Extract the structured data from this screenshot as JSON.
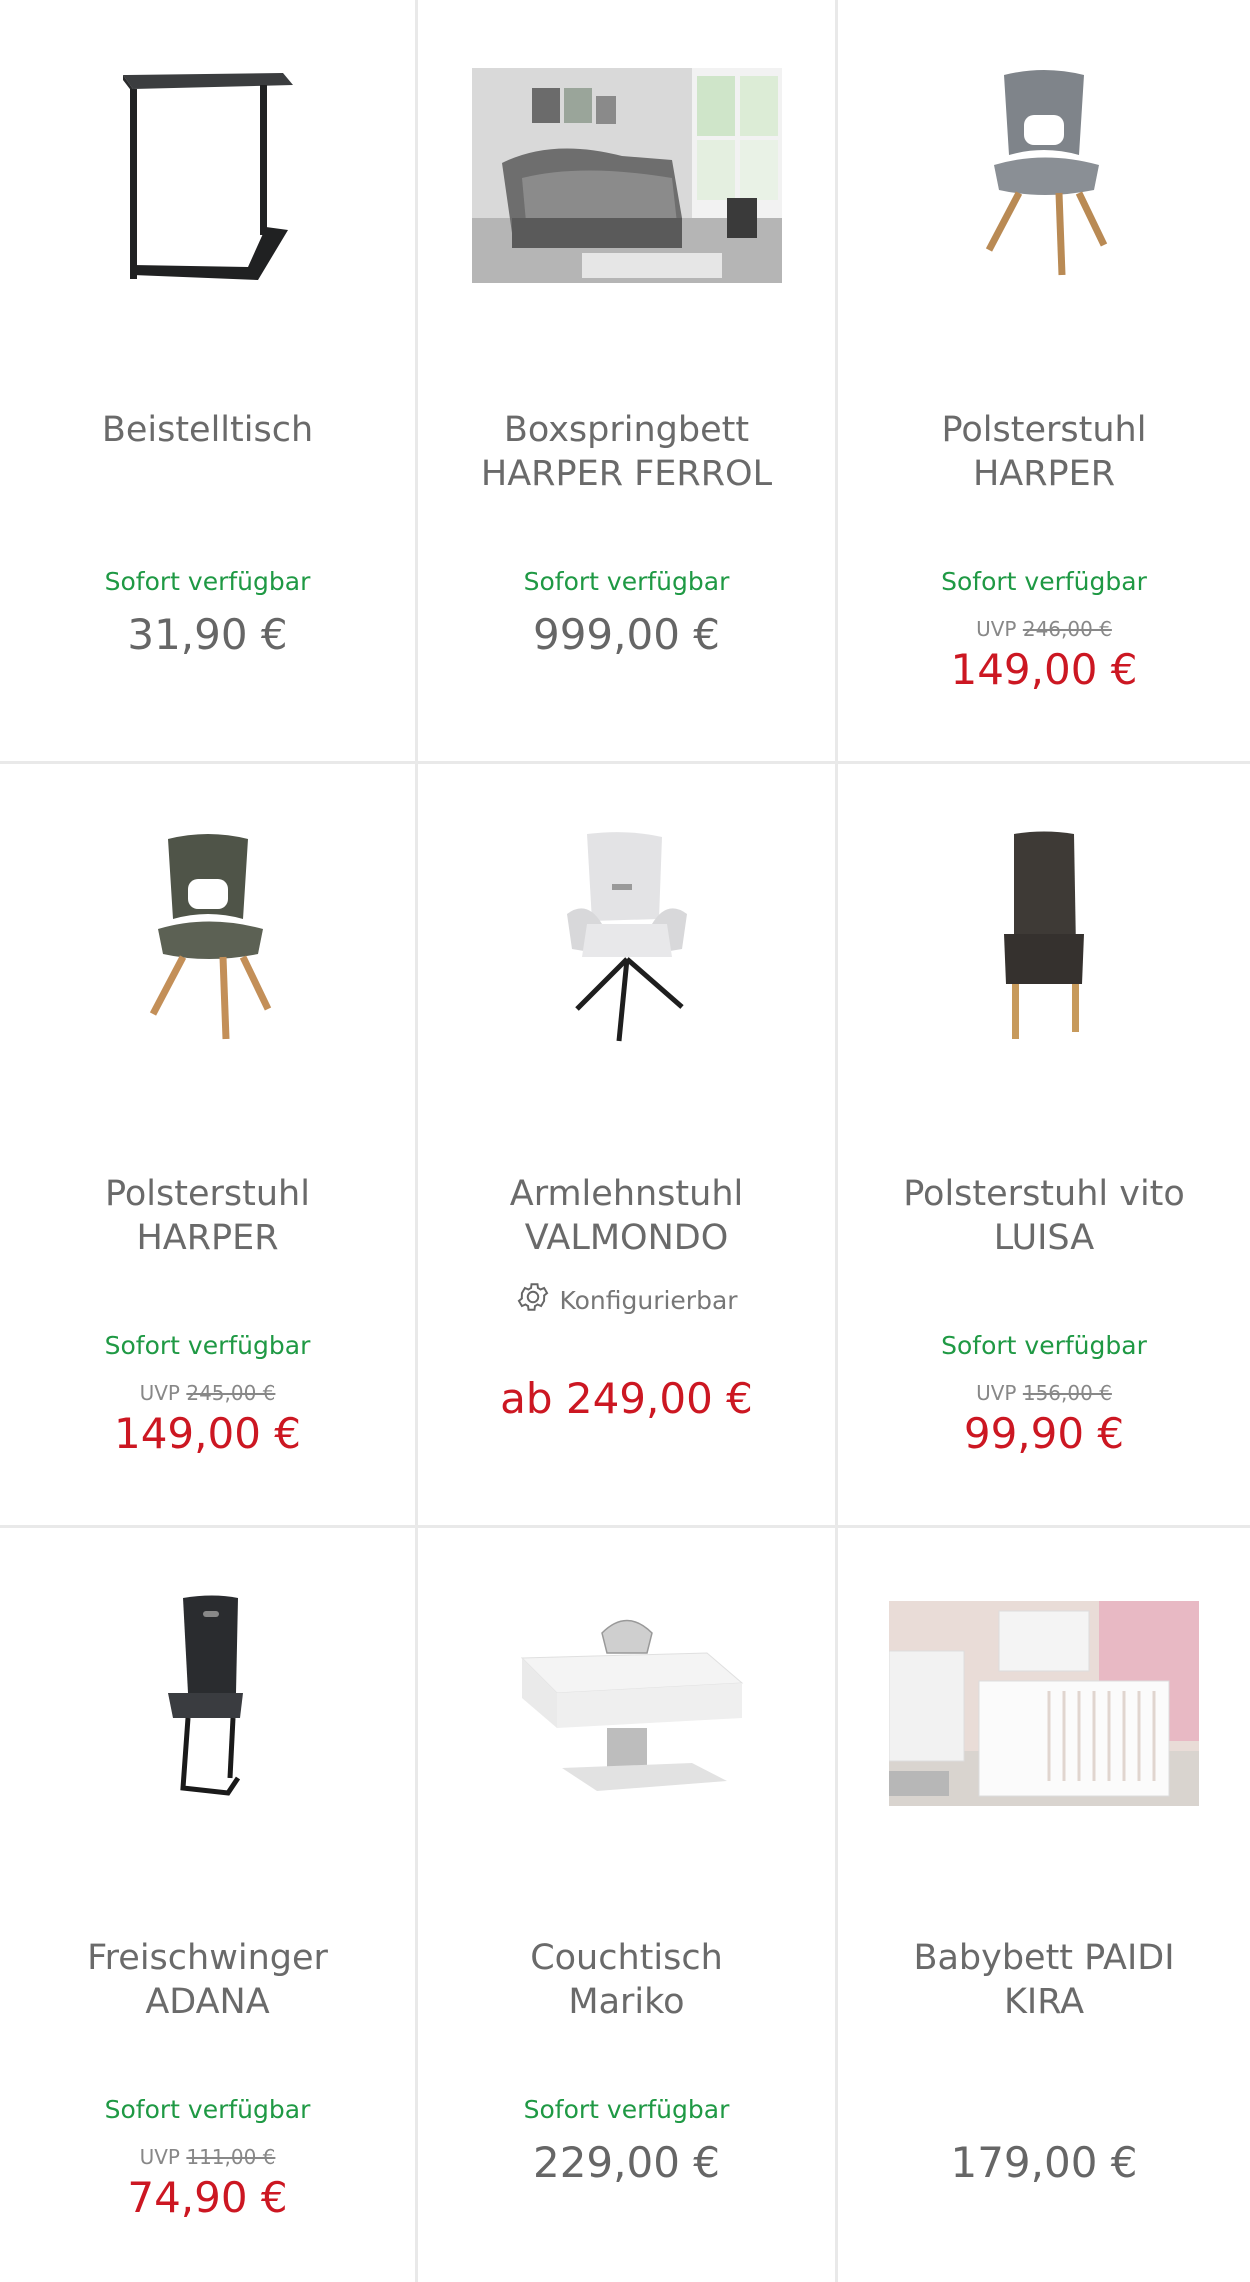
{
  "products": [
    {
      "name": "Beistelltisch",
      "availability": "Sofort verfügbar",
      "uvp_label": "",
      "uvp_value": "",
      "price": "31,90 €",
      "config": ""
    },
    {
      "name": "Boxspringbett\nHARPER FERROL",
      "availability": "Sofort verfügbar",
      "uvp_label": "",
      "uvp_value": "",
      "price": "999,00 €",
      "config": ""
    },
    {
      "name": "Polsterstuhl\nHARPER",
      "availability": "Sofort verfügbar",
      "uvp_label": "UVP",
      "uvp_value": "246,00 €",
      "price": "149,00 €",
      "config": ""
    },
    {
      "name": "Polsterstuhl\nHARPER",
      "availability": "Sofort verfügbar",
      "uvp_label": "UVP",
      "uvp_value": "245,00 €",
      "price": "149,00 €",
      "config": ""
    },
    {
      "name": "Armlehnstuhl\nVALMONDO",
      "availability": "",
      "uvp_label": "",
      "uvp_value": "",
      "price": "ab 249,00 €",
      "config": "Konfigurierbar"
    },
    {
      "name": "Polsterstuhl vito\nLUISA",
      "availability": "Sofort verfügbar",
      "uvp_label": "UVP",
      "uvp_value": "156,00 €",
      "price": "99,90 €",
      "config": ""
    },
    {
      "name": "Freischwinger\nADANA",
      "availability": "Sofort verfügbar",
      "uvp_label": "UVP",
      "uvp_value": "111,00 €",
      "price": "74,90 €",
      "config": ""
    },
    {
      "name": "Couchtisch\nMariko",
      "availability": "Sofort verfügbar",
      "uvp_label": "",
      "uvp_value": "",
      "price": "229,00 €",
      "config": ""
    },
    {
      "name": "Babybett PAIDI\nKIRA",
      "availability": "",
      "uvp_label": "",
      "uvp_value": "",
      "price": "179,00 €",
      "config": ""
    }
  ],
  "colors": {
    "available": "#1f9944",
    "sale": "#cc1722",
    "price": "#666666",
    "divider": "#e9e9e9"
  }
}
